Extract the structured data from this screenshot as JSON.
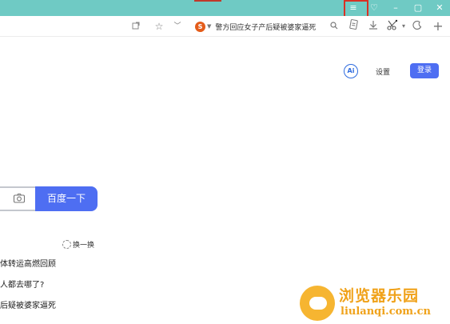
{
  "window": {
    "menu_icon": "≡",
    "skin_icon": "♡",
    "minimize": "–",
    "restore": "▢",
    "close": "✕"
  },
  "toolbar": {
    "hot_search_text": "警方回应女子产后疑被婆家逼死",
    "hot_search_logo": "S"
  },
  "header": {
    "ai_label": "Ai",
    "settings_label": "设置",
    "login_label": "登录"
  },
  "search": {
    "button_label": "百度一下"
  },
  "hotlist": {
    "refresh_label": "换一换",
    "items": [
      "体转运高燃回顾",
      "人都去哪了?",
      "后疑被婆家逼死"
    ]
  },
  "watermark": {
    "title": "浏览器乐园",
    "url": "liulanqi.com.cn"
  },
  "colors": {
    "titlebar": "#6fcac4",
    "accent": "#4e6ef2",
    "highlight": "#d93025",
    "watermark": "#f0a21a"
  }
}
